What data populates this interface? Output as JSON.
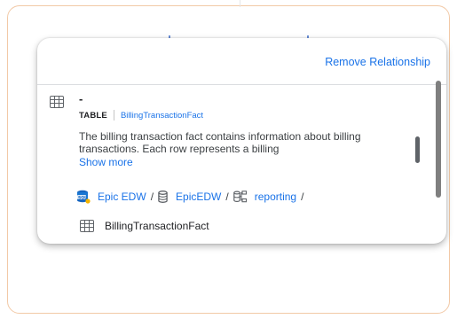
{
  "header": {
    "remove_relationship_label": "Remove Relationship"
  },
  "entry": {
    "title": "-",
    "type_label": "TABLE",
    "table_name": "BillingTransactionFact",
    "description": "The billing transaction fact contains information about billing transactions. Each row represents a billing",
    "show_more_label": "Show more"
  },
  "path": {
    "system": "Epic EDW",
    "database": "EpicEDW",
    "schema": "reporting",
    "separator": "/"
  },
  "table_row": {
    "name": "BillingTransactionFact"
  },
  "icons": {
    "entry_type": "table-icon",
    "system": "sql-database-icon",
    "database": "database-icon",
    "schema": "schema-icon",
    "table": "table-icon"
  },
  "colors": {
    "link": "#1a73e8",
    "frame_border": "#f2c9a6"
  }
}
